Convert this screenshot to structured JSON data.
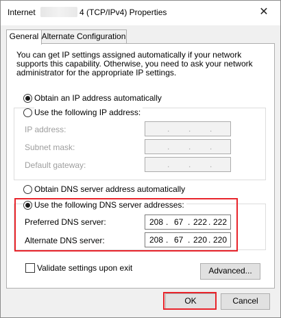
{
  "titlebar": {
    "title_left": "Internet",
    "title_right": "4 (TCP/IPv4) Properties",
    "close_symbol": "✕"
  },
  "tabs": [
    {
      "label": "General"
    },
    {
      "label": "Alternate Configuration"
    }
  ],
  "description": "You can get IP settings assigned automatically if your network supports this capability. Otherwise, you need to ask your network administrator for the appropriate IP settings.",
  "ip_mode": {
    "auto_label": "Obtain an IP address automatically",
    "manual_label": "Use the following IP address:",
    "selected": "auto"
  },
  "ip_fields": [
    {
      "label": "IP address:",
      "value": " .  .  . "
    },
    {
      "label": "Subnet mask:",
      "value": " .  .  . "
    },
    {
      "label": "Default gateway:",
      "value": " .  .  . "
    }
  ],
  "dns_mode": {
    "auto_label": "Obtain DNS server address automatically",
    "manual_label": "Use the following DNS server addresses:",
    "selected": "manual"
  },
  "dns_fields": {
    "preferred": {
      "label": "Preferred DNS server:",
      "octets": [
        "208",
        "67",
        "222",
        "222"
      ]
    },
    "alternate": {
      "label": "Alternate DNS server:",
      "octets": [
        "208",
        "67",
        "220",
        "220"
      ]
    }
  },
  "validate": {
    "label": "Validate settings upon exit",
    "checked": false
  },
  "buttons": {
    "advanced": "Advanced...",
    "ok": "OK",
    "cancel": "Cancel"
  },
  "colors": {
    "highlight": "#e8232a",
    "panel": "#ffffff",
    "window": "#f0f0f0"
  }
}
